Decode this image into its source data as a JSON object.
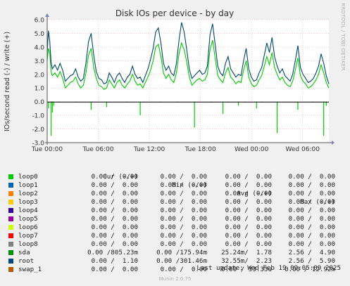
{
  "chart_data": {
    "type": "line",
    "title": "Disk IOs per device - by day",
    "ylabel": "IOs/second read (-) / write (+)",
    "ylim": [
      -3.0,
      6.0
    ],
    "yticks": [
      6.0,
      5.0,
      4.0,
      3.0,
      2.0,
      1.0,
      0.0,
      -1.0,
      -2.0,
      -3.0
    ],
    "ytick_labels": [
      "6.0",
      "5.0",
      "4.0",
      "3.0",
      "2.0",
      "1.0",
      "0.0",
      "-1.0",
      "-2.0",
      "-3.0"
    ],
    "xlim": [
      "Tue 00:00",
      "Wed 09:05"
    ],
    "xtick_labels": [
      "Tue 00:00",
      "Tue 06:00",
      "Tue 12:00",
      "Tue 18:00",
      "Wed 00:00",
      "Wed 06:00"
    ],
    "grid": true,
    "series": [
      {
        "name": "sda",
        "color": "#00cc00",
        "write_x_hours": [
          0,
          0.5,
          1,
          1.5,
          2,
          3,
          4,
          5,
          6,
          7,
          8,
          9,
          10,
          11,
          12,
          13,
          14,
          15,
          16,
          17,
          18,
          19,
          20,
          21,
          22,
          23,
          24,
          25,
          26,
          27,
          28,
          29,
          30,
          31,
          32,
          33,
          33.5,
          34,
          35,
          36,
          37,
          38,
          39,
          40,
          41,
          42,
          43,
          44,
          45,
          46,
          47,
          48,
          49,
          50,
          51,
          52,
          53,
          54,
          55,
          56,
          57,
          58,
          59,
          60,
          61,
          62,
          63,
          64,
          65,
          66,
          67,
          68,
          69,
          70,
          71,
          72,
          73,
          74,
          75,
          76,
          77,
          78,
          79,
          80,
          81,
          82,
          83,
          84,
          85,
          86,
          87,
          88,
          89,
          90,
          91,
          92,
          93,
          94,
          95,
          96,
          97,
          98,
          99,
          100,
          101,
          102,
          103,
          104,
          105,
          106,
          107,
          108,
          109
        ],
        "write_y": [
          3.0,
          3.9,
          3.6,
          2.2,
          1.9,
          2.1,
          1.8,
          2.2,
          1.7,
          1.0,
          1.2,
          1.4,
          1.5,
          1.8,
          1.3,
          1.0,
          1.2,
          2.1,
          3.4,
          3.9,
          2.5,
          1.7,
          1.2,
          1.1,
          0.9,
          1.0,
          1.6,
          1.3,
          1.0,
          1.4,
          1.6,
          1.2,
          1.0,
          1.3,
          1.5,
          2.0,
          1.8,
          1.5,
          1.2,
          1.3,
          1.0,
          1.4,
          1.8,
          2.3,
          3.0,
          4.0,
          4.2,
          3.3,
          2.1,
          1.7,
          2.0,
          1.6,
          1.4,
          2.1,
          3.5,
          4.3,
          3.8,
          2.9,
          1.8,
          1.2,
          1.4,
          1.6,
          1.7,
          1.5,
          1.6,
          2.0,
          3.8,
          4.5,
          3.2,
          1.9,
          1.6,
          1.4,
          2.1,
          2.5,
          1.8,
          1.6,
          1.3,
          1.5,
          1.4,
          2.3,
          3.0,
          1.8,
          1.3,
          1.1,
          1.2,
          1.6,
          1.9,
          2.6,
          3.3,
          2.7,
          3.6,
          2.5,
          2.0,
          1.6,
          1.8,
          1.4,
          1.2,
          1.1,
          1.5,
          2.3,
          3.2,
          1.9,
          1.5,
          1.3,
          1.0,
          1.1,
          1.3,
          1.6,
          2.0,
          2.7,
          2.1,
          1.4,
          1.0
        ],
        "read_x_hours": [
          0.5,
          1.5,
          2,
          2.5,
          17,
          23,
          36,
          57,
          68,
          74,
          81,
          89,
          97,
          107,
          108
        ],
        "read_y": [
          -0.5,
          -2.5,
          -0.8,
          -0.3,
          -0.6,
          -0.4,
          -1.0,
          -1.9,
          -0.9,
          -0.3,
          -0.5,
          -2.3,
          -0.6,
          -2.5,
          -0.3
        ]
      },
      {
        "name": "root",
        "color": "#00466b",
        "write_x_hours": [
          0,
          0.5,
          1,
          1.5,
          2,
          3,
          4,
          5,
          6,
          7,
          8,
          9,
          10,
          11,
          12,
          13,
          14,
          15,
          16,
          17,
          18,
          19,
          20,
          21,
          22,
          23,
          24,
          25,
          26,
          27,
          28,
          29,
          30,
          31,
          32,
          33,
          33.5,
          34,
          35,
          36,
          37,
          38,
          39,
          40,
          41,
          42,
          43,
          44,
          45,
          46,
          47,
          48,
          49,
          50,
          51,
          52,
          53,
          54,
          55,
          56,
          57,
          58,
          59,
          60,
          61,
          62,
          63,
          64,
          65,
          66,
          67,
          68,
          69,
          70,
          71,
          72,
          73,
          74,
          75,
          76,
          77,
          78,
          79,
          80,
          81,
          82,
          83,
          84,
          85,
          86,
          87,
          88,
          89,
          90,
          91,
          92,
          93,
          94,
          95,
          96,
          97,
          98,
          99,
          100,
          101,
          102,
          103,
          104,
          105,
          106,
          107,
          108,
          109
        ],
        "write_y": [
          3.6,
          5.2,
          4.4,
          2.9,
          2.4,
          2.7,
          2.3,
          2.8,
          2.3,
          1.5,
          1.7,
          1.9,
          2.0,
          2.4,
          1.8,
          1.5,
          1.7,
          2.8,
          4.4,
          5.0,
          3.4,
          2.2,
          1.7,
          1.6,
          1.3,
          1.4,
          2.1,
          1.8,
          1.4,
          1.9,
          2.1,
          1.7,
          1.4,
          1.8,
          2.0,
          2.6,
          2.3,
          2.0,
          1.7,
          1.8,
          1.4,
          1.9,
          2.4,
          3.1,
          3.9,
          5.1,
          5.4,
          4.3,
          2.8,
          2.3,
          2.6,
          2.1,
          1.9,
          2.8,
          4.5,
          5.8,
          5.1,
          3.8,
          2.4,
          1.7,
          1.9,
          2.1,
          2.3,
          2.0,
          2.1,
          2.6,
          4.9,
          5.7,
          4.2,
          2.6,
          2.1,
          1.9,
          2.8,
          3.3,
          2.4,
          2.1,
          1.8,
          2.0,
          1.9,
          3.0,
          3.9,
          2.4,
          1.8,
          1.5,
          1.6,
          2.1,
          2.5,
          3.4,
          4.3,
          3.6,
          4.7,
          3.3,
          2.6,
          2.1,
          2.4,
          1.9,
          1.7,
          1.5,
          2.0,
          3.0,
          4.1,
          2.5,
          2.0,
          1.7,
          1.4,
          1.5,
          1.7,
          2.1,
          2.6,
          3.5,
          2.8,
          1.9,
          1.3
        ],
        "read_x_hours": [],
        "read_y": []
      }
    ]
  },
  "legend": {
    "header": {
      "cur": "Cur (-/+)",
      "min": "Min (-/+)",
      "avg": "Avg (-/+)",
      "max": "Max (-/+)"
    },
    "rows": [
      {
        "name": "loop0",
        "color": "#00cc00",
        "cur": "0.00 /  0.00",
        "min": "0.00 /  0.00",
        "avg": "0.00 /  0.00",
        "max": "0.00 /  0.00"
      },
      {
        "name": "loop1",
        "color": "#0066b3",
        "cur": "0.00 /  0.00",
        "min": "0.00 /  0.00",
        "avg": "0.00 /  0.00",
        "max": "0.00 /  0.00"
      },
      {
        "name": "loop2",
        "color": "#ff8000",
        "cur": "0.00 /  0.00",
        "min": "0.00 /  0.00",
        "avg": "0.00 /  0.00",
        "max": "0.00 /  0.00"
      },
      {
        "name": "loop3",
        "color": "#ffcc00",
        "cur": "0.00 /  0.00",
        "min": "0.00 /  0.00",
        "avg": "0.00 /  0.00",
        "max": "0.00 /  0.00"
      },
      {
        "name": "loop4",
        "color": "#330099",
        "cur": "0.00 /  0.00",
        "min": "0.00 /  0.00",
        "avg": "0.00 /  0.00",
        "max": "0.00 /  0.00"
      },
      {
        "name": "loop5",
        "color": "#990099",
        "cur": "0.00 /  0.00",
        "min": "0.00 /  0.00",
        "avg": "0.00 /  0.00",
        "max": "0.00 /  0.00"
      },
      {
        "name": "loop6",
        "color": "#ccff00",
        "cur": "0.00 /  0.00",
        "min": "0.00 /  0.00",
        "avg": "0.00 /  0.00",
        "max": "0.00 /  0.00"
      },
      {
        "name": "loop7",
        "color": "#ff0000",
        "cur": "0.00 /  0.00",
        "min": "0.00 /  0.00",
        "avg": "0.00 /  0.00",
        "max": "0.00 /  0.00"
      },
      {
        "name": "loop8",
        "color": "#808080",
        "cur": "0.00 /  0.00",
        "min": "0.00 /  0.00",
        "avg": "0.00 /  0.00",
        "max": "0.00 /  0.00"
      },
      {
        "name": "sda",
        "color": "#008f00",
        "cur": "0.00 /805.23m",
        "min": "0.00 /175.94m",
        "avg": "25.24m/  1.78",
        "max": "2.56 /  4.90"
      },
      {
        "name": "root",
        "color": "#00487d",
        "cur": "0.00 /  1.10",
        "min": "0.00 /301.46m",
        "avg": "32.55m/  2.23",
        "max": "2.56 /  5.90"
      },
      {
        "name": "swap_1",
        "color": "#b35a00",
        "cur": "0.00 /  0.00",
        "min": "0.00 /  0.00",
        "avg": "0.00 / 33.33u",
        "max": "0.00 / 12.92m"
      }
    ]
  },
  "last_update": "Last update: Wed Feb 19 09:05:09 2025",
  "footer": "Munin 2.0.75",
  "rrd_credit": "RRDTOOL / TOBI OETIKER"
}
